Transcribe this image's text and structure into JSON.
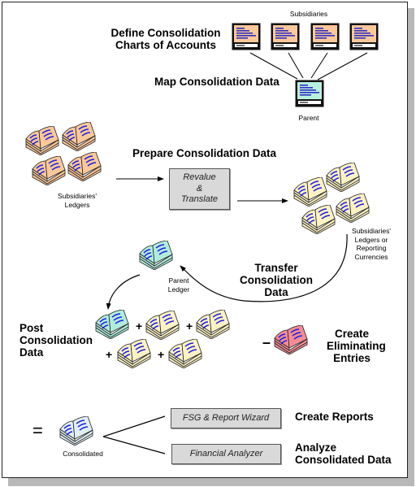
{
  "diagram": {
    "steps": {
      "define_coa": "Define Consolidation\nCharts of Accounts",
      "map_data": "Map Consolidation Data",
      "prepare_data": "Prepare Consolidation Data",
      "transfer_data": "Transfer\nConsolidation\nData",
      "post_data": "Post\nConsolidation\nData",
      "create_eliminating": "Create\nEliminating\nEntries",
      "create_reports": "Create Reports",
      "analyze_data": "Analyze\nConsolidated Data"
    },
    "labels": {
      "subsidiaries": "Subsidiaries",
      "parent": "Parent",
      "subsidiaries_ledgers": "Subsidiaries'\nLedgers",
      "subsidiaries_ledgers_or_reporting": "Subsidiaries'\nLedgers or\nReporting\nCurrencies",
      "parent_ledger": "Parent\nLedger",
      "consolidated": "Consolidated"
    },
    "tools": {
      "revalue_translate": "Revalue\n&\nTranslate",
      "fsg_report_wizard": "FSG & Report Wizard",
      "financial_analyzer": "Financial Analyzer"
    },
    "operators": {
      "plus": "+",
      "minus": "–",
      "equals": "="
    },
    "colors": {
      "subsidiary_screen": "#fbc89a",
      "parent_screen": "#b8f0e0",
      "subsidiary_book": "#fbc89a",
      "reporting_book": "#fbf2c4",
      "parent_book": "#b0ecdc",
      "eliminating_book": "#f48c94",
      "lines": "#2020e0"
    }
  }
}
